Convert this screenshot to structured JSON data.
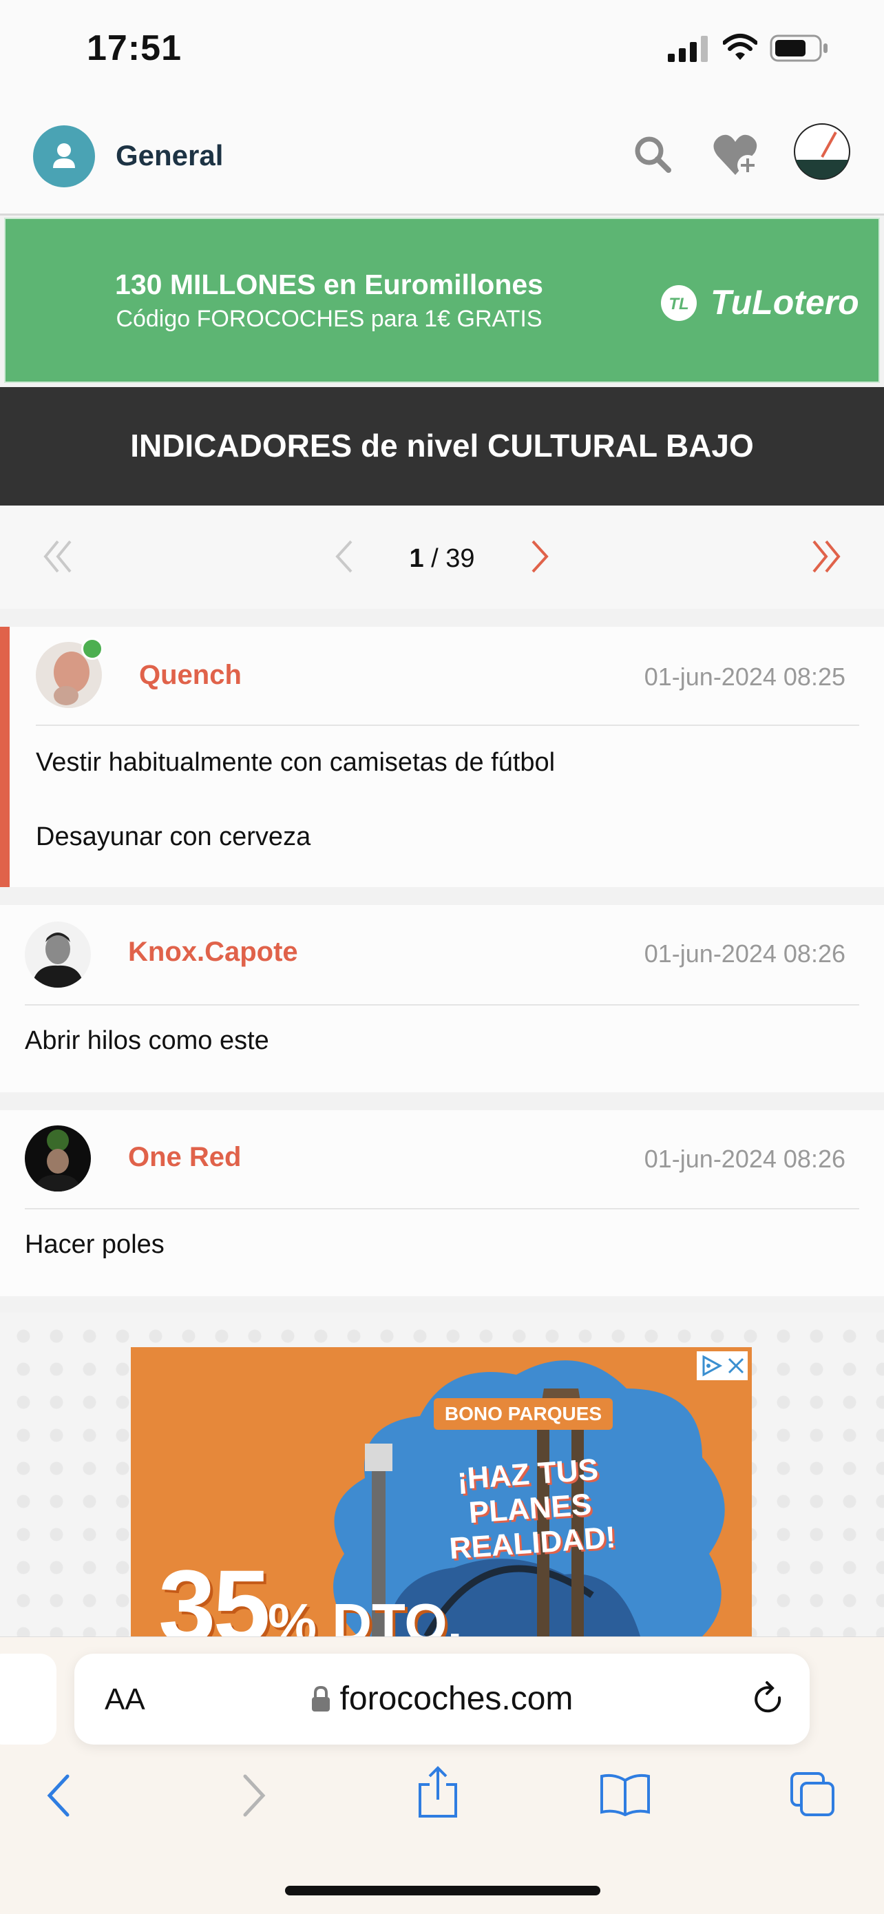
{
  "status_bar": {
    "time": "17:51"
  },
  "header": {
    "section": "General",
    "icons": [
      "user-icon",
      "search-icon",
      "heart-plus-icon",
      "speedometer-icon"
    ]
  },
  "banner": {
    "line1": "130 MILLONES en Euromillones",
    "line2": "Código FOROCOCHES para 1€ GRATIS",
    "brand": "TuLotero",
    "brand_badge": "TL",
    "color": "#5db573"
  },
  "thread": {
    "title": "INDICADORES de nivel CULTURAL BAJO"
  },
  "pagination": {
    "current": "1",
    "total": "/ 39"
  },
  "posts": [
    {
      "author": "Quench",
      "date": "01-jun-2024 08:25",
      "online": true,
      "lines": [
        "Vestir habitualmente con camisetas de fútbol",
        "Desayunar con cerveza"
      ]
    },
    {
      "author": "Knox.Capote",
      "date": "01-jun-2024 08:26",
      "lines": [
        "Abrir hilos como este"
      ]
    },
    {
      "author": "One Red",
      "date": "01-jun-2024 08:26",
      "lines": [
        "Hacer poles"
      ]
    }
  ],
  "ad": {
    "brand_tag": "BONO PARQUES",
    "slogan_1": "¡HAZ TUS",
    "slogan_2": "PLANES REALIDAD!",
    "discount": "35",
    "discount_suffix": "% DTO."
  },
  "browser": {
    "text_size_label": "AA",
    "url": "forocoches.com"
  },
  "colors": {
    "accent": "#e0624a",
    "title_bar": "#333333",
    "online": "#4caf50"
  }
}
